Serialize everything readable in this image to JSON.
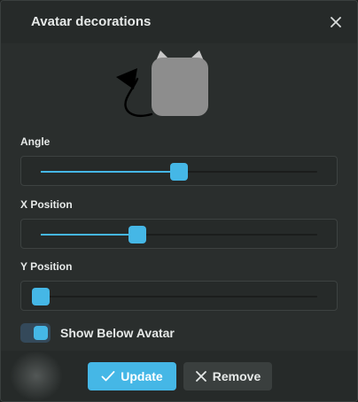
{
  "dialog": {
    "title": "Avatar decorations",
    "close_icon": "close-icon"
  },
  "preview": {
    "arrow_icon": "curved-arrow-icon",
    "avatar_color": "#8d8d8d",
    "decoration": "cat-ears"
  },
  "controls": {
    "angle": {
      "label": "Angle",
      "value_fraction": 0.5
    },
    "x_position": {
      "label": "X Position",
      "value_fraction": 0.35
    },
    "y_position": {
      "label": "Y Position",
      "value_fraction": 0.0
    },
    "show_below": {
      "label": "Show Below Avatar",
      "checked": true
    }
  },
  "buttons": {
    "update": {
      "label": "Update",
      "icon": "check-icon"
    },
    "remove": {
      "label": "Remove",
      "icon": "x-icon"
    }
  },
  "colors": {
    "accent": "#45b7e6",
    "background": "#2a2e2d"
  }
}
